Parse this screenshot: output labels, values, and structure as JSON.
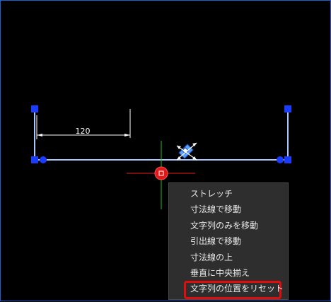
{
  "drawing": {
    "dimension_value": "120"
  },
  "context_menu": {
    "items": [
      {
        "label": "ストレッチ"
      },
      {
        "label": "寸法線で移動"
      },
      {
        "label": "文字列のみを移動"
      },
      {
        "label": "引出線で移動"
      },
      {
        "label": "寸法線の上"
      },
      {
        "label": "垂直に中央揃え"
      },
      {
        "label": "文字列の位置をリセット",
        "highlighted": true
      }
    ]
  },
  "colors": {
    "background": "#000000",
    "line": "#a9c7ff",
    "grip": "#1a3cff",
    "crosshair_x": "#e02020",
    "crosshair_y": "#20c020",
    "cursor_marker": "#e01818",
    "menu_bg": "#2e2e2e",
    "highlight": "#e10d0d"
  }
}
